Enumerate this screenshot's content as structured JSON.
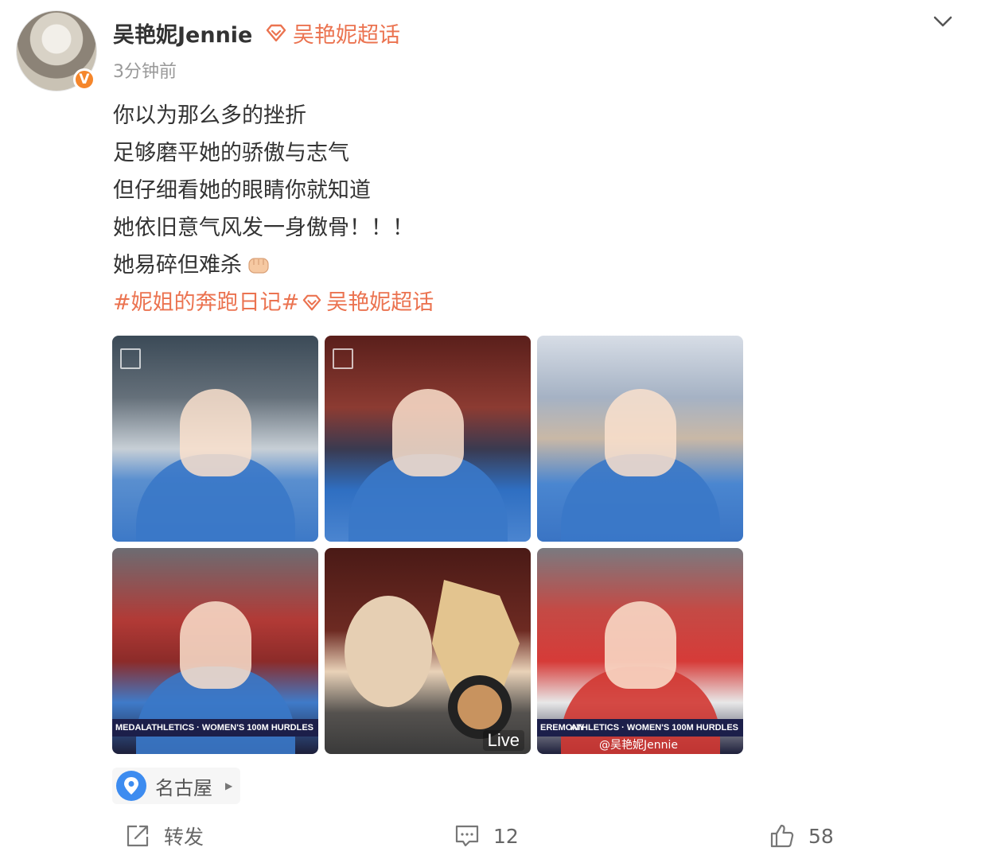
{
  "post": {
    "username": "吴艳妮Jennie",
    "supertopic_label": "吴艳妮超话",
    "time": "3分钟前",
    "verified_icon": "V",
    "lines": [
      "你以为那么多的挫折",
      "足够磨平她的骄傲与志气",
      "但仔细看她的眼睛你就知道",
      "她依旧意气风发一身傲骨！！！",
      "她易碎但难杀"
    ],
    "hashtag": "#妮姐的奔跑日记#",
    "hashtag_supertopic": "吴艳妮超话",
    "location": "名古屋"
  },
  "photos": {
    "p4_banner_left": "MEDAL",
    "p4_banner_right": "ATHLETICS · WOMEN'S 100M HURDLES",
    "p5_live": "Live",
    "p6_banner_left": "EREMONY",
    "p6_banner_right": "ATHLETICS · WOMEN'S 100M HURDLES",
    "p6_watermark": "@吴艳妮Jennie"
  },
  "actions": {
    "repost_label": "转发",
    "comment_count": "12",
    "like_count": "58"
  },
  "colors": {
    "accent": "#eb7350",
    "verified": "#f5862b",
    "pin_blue": "#3d8cf0"
  }
}
